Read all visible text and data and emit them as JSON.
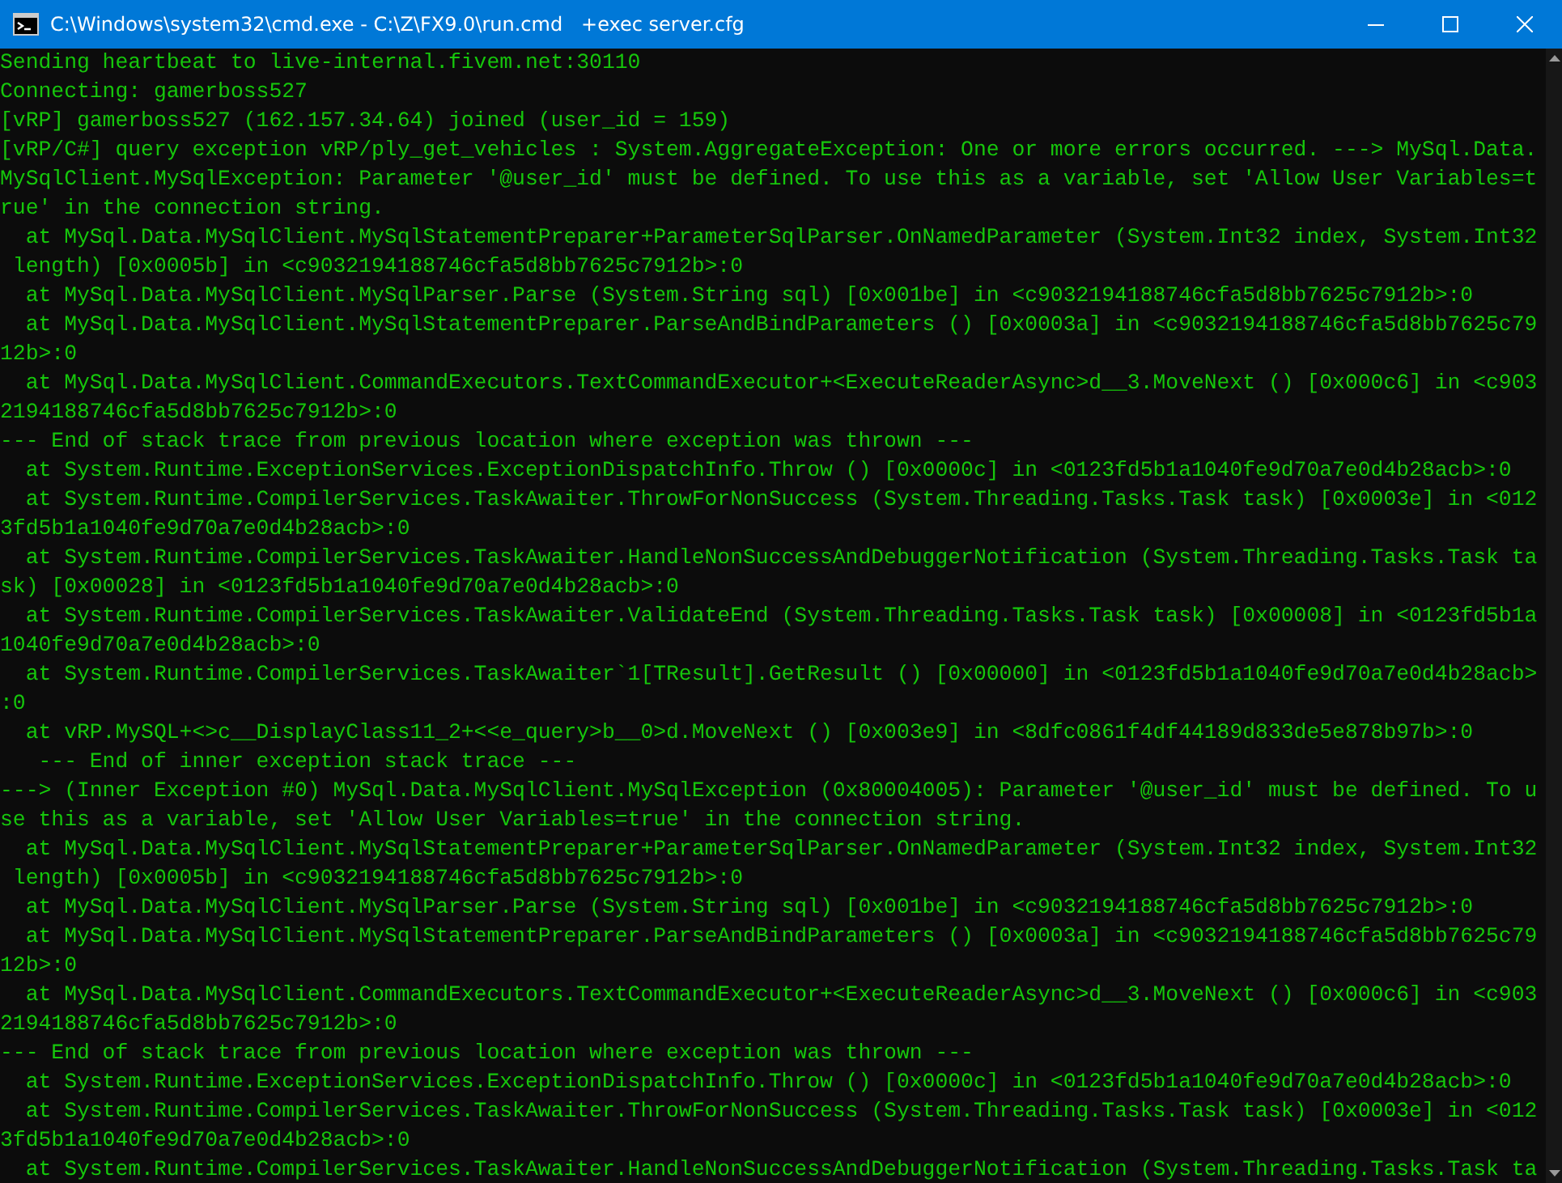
{
  "window": {
    "title": "C:\\Windows\\system32\\cmd.exe - C:\\Z\\FX9.0\\run.cmd   +exec server.cfg"
  },
  "console": {
    "lines": [
      "Sending heartbeat to live-internal.fivem.net:30110",
      "Connecting: gamerboss527",
      "[vRP] gamerboss527 (162.157.34.64) joined (user_id = 159)",
      "[vRP/C#] query exception vRP/ply_get_vehicles : System.AggregateException: One or more errors occurred. ---> MySql.Data.",
      "MySqlClient.MySqlException: Parameter '@user_id' must be defined. To use this as a variable, set 'Allow User Variables=t",
      "rue' in the connection string.",
      "  at MySql.Data.MySqlClient.MySqlStatementPreparer+ParameterSqlParser.OnNamedParameter (System.Int32 index, System.Int32",
      " length) [0x0005b] in <c9032194188746cfa5d8bb7625c7912b>:0",
      "  at MySql.Data.MySqlClient.MySqlParser.Parse (System.String sql) [0x001be] in <c9032194188746cfa5d8bb7625c7912b>:0",
      "  at MySql.Data.MySqlClient.MySqlStatementPreparer.ParseAndBindParameters () [0x0003a] in <c9032194188746cfa5d8bb7625c79",
      "12b>:0",
      "  at MySql.Data.MySqlClient.CommandExecutors.TextCommandExecutor+<ExecuteReaderAsync>d__3.MoveNext () [0x000c6] in <c903",
      "2194188746cfa5d8bb7625c7912b>:0",
      "--- End of stack trace from previous location where exception was thrown ---",
      "  at System.Runtime.ExceptionServices.ExceptionDispatchInfo.Throw () [0x0000c] in <0123fd5b1a1040fe9d70a7e0d4b28acb>:0",
      "  at System.Runtime.CompilerServices.TaskAwaiter.ThrowForNonSuccess (System.Threading.Tasks.Task task) [0x0003e] in <012",
      "3fd5b1a1040fe9d70a7e0d4b28acb>:0",
      "  at System.Runtime.CompilerServices.TaskAwaiter.HandleNonSuccessAndDebuggerNotification (System.Threading.Tasks.Task ta",
      "sk) [0x00028] in <0123fd5b1a1040fe9d70a7e0d4b28acb>:0",
      "  at System.Runtime.CompilerServices.TaskAwaiter.ValidateEnd (System.Threading.Tasks.Task task) [0x00008] in <0123fd5b1a",
      "1040fe9d70a7e0d4b28acb>:0",
      "  at System.Runtime.CompilerServices.TaskAwaiter`1[TResult].GetResult () [0x00000] in <0123fd5b1a1040fe9d70a7e0d4b28acb>",
      ":0",
      "  at vRP.MySQL+<>c__DisplayClass11_2+<<e_query>b__0>d.MoveNext () [0x003e9] in <8dfc0861f4df44189d833de5e878b97b>:0",
      "   --- End of inner exception stack trace ---",
      "---> (Inner Exception #0) MySql.Data.MySqlClient.MySqlException (0x80004005): Parameter '@user_id' must be defined. To u",
      "se this as a variable, set 'Allow User Variables=true' in the connection string.",
      "  at MySql.Data.MySqlClient.MySqlStatementPreparer+ParameterSqlParser.OnNamedParameter (System.Int32 index, System.Int32",
      " length) [0x0005b] in <c9032194188746cfa5d8bb7625c7912b>:0",
      "  at MySql.Data.MySqlClient.MySqlParser.Parse (System.String sql) [0x001be] in <c9032194188746cfa5d8bb7625c7912b>:0",
      "  at MySql.Data.MySqlClient.MySqlStatementPreparer.ParseAndBindParameters () [0x0003a] in <c9032194188746cfa5d8bb7625c79",
      "12b>:0",
      "  at MySql.Data.MySqlClient.CommandExecutors.TextCommandExecutor+<ExecuteReaderAsync>d__3.MoveNext () [0x000c6] in <c903",
      "2194188746cfa5d8bb7625c7912b>:0",
      "--- End of stack trace from previous location where exception was thrown ---",
      "  at System.Runtime.ExceptionServices.ExceptionDispatchInfo.Throw () [0x0000c] in <0123fd5b1a1040fe9d70a7e0d4b28acb>:0",
      "  at System.Runtime.CompilerServices.TaskAwaiter.ThrowForNonSuccess (System.Threading.Tasks.Task task) [0x0003e] in <012",
      "3fd5b1a1040fe9d70a7e0d4b28acb>:0",
      "  at System.Runtime.CompilerServices.TaskAwaiter.HandleNonSuccessAndDebuggerNotification (System.Threading.Tasks.Task ta"
    ]
  }
}
